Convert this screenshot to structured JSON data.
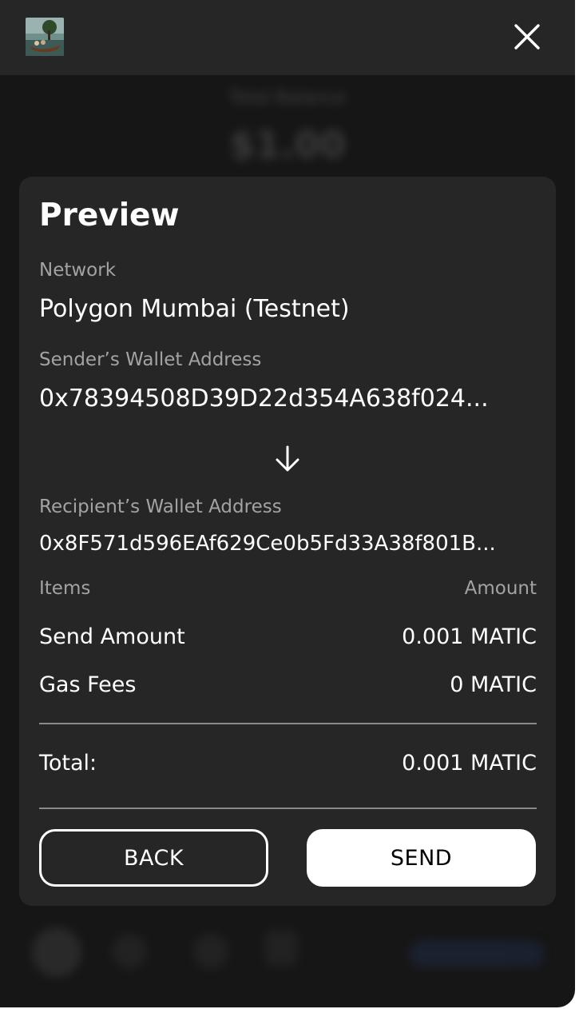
{
  "background": {
    "balance_label": "Total Balance",
    "balance_value": "$1.00"
  },
  "preview": {
    "title": "Preview",
    "network_label": "Network",
    "network_value": "Polygon Mumbai (Testnet)",
    "sender_label": "Sender’s Wallet Address",
    "sender_address": "0x78394508D39D22d354A638f024...",
    "recipient_label": "Recipient’s Wallet Address",
    "recipient_address": "0x8F571d596EAf629Ce0b5Fd33A38f801B...",
    "items_header": "Items",
    "amount_header": "Amount",
    "rows": [
      {
        "item": "Send Amount",
        "amount": "0.001 MATIC"
      },
      {
        "item": "Gas Fees",
        "amount": "0 MATIC"
      }
    ],
    "total_label": "Total:",
    "total_value": "0.001 MATIC",
    "back_label": "BACK",
    "send_label": "SEND"
  },
  "icons": {
    "close": "close-icon",
    "arrow": "arrow-down-icon",
    "avatar": "avatar-image"
  },
  "colors": {
    "window_bg": "#161616",
    "panel_bg": "#262626",
    "label_text": "#a3a3a3",
    "primary_text": "#ffffff",
    "send_button_bg": "#ffffff"
  }
}
